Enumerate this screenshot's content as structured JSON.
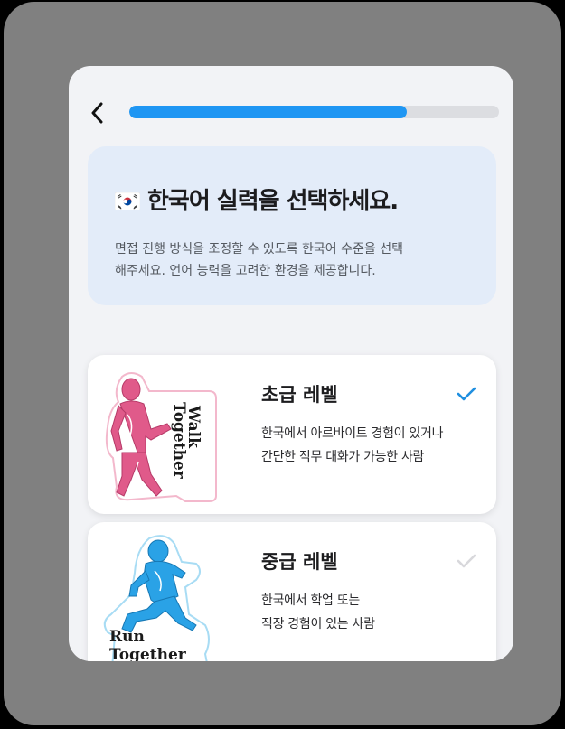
{
  "header": {
    "back_icon": "chevron-left-icon",
    "progress": 0.75
  },
  "intro": {
    "flag_icon": "south-korea-flag-icon",
    "title": "한국어 실력을 선택하세요.",
    "description_line1": "면접 진행 방식을 조정할 수 있도록 한국어 수준을 선택",
    "description_line2": "해주세요. 언어 능력을 고려한 환경을 제공합니다."
  },
  "levels": [
    {
      "title": "초급 레벨",
      "desc_line1": "한국에서 아르바이트 경험이 있거나",
      "desc_line2": "간단한 직무 대화가 가능한 사람",
      "selected": true,
      "sticker_text_1": "Walk",
      "sticker_text_2": "Together",
      "sticker_color": "#e05a8a"
    },
    {
      "title": "중급 레벨",
      "desc_line1": "한국에서 학업 또는",
      "desc_line2": "직장 경험이 있는 사람",
      "selected": false,
      "sticker_text_1": "Run",
      "sticker_text_2": "Together",
      "sticker_color": "#2aa2e6"
    }
  ],
  "colors": {
    "accent": "#1f96f3",
    "check_selected": "#1f8fe0",
    "check_unselected": "#d8d8dc"
  }
}
